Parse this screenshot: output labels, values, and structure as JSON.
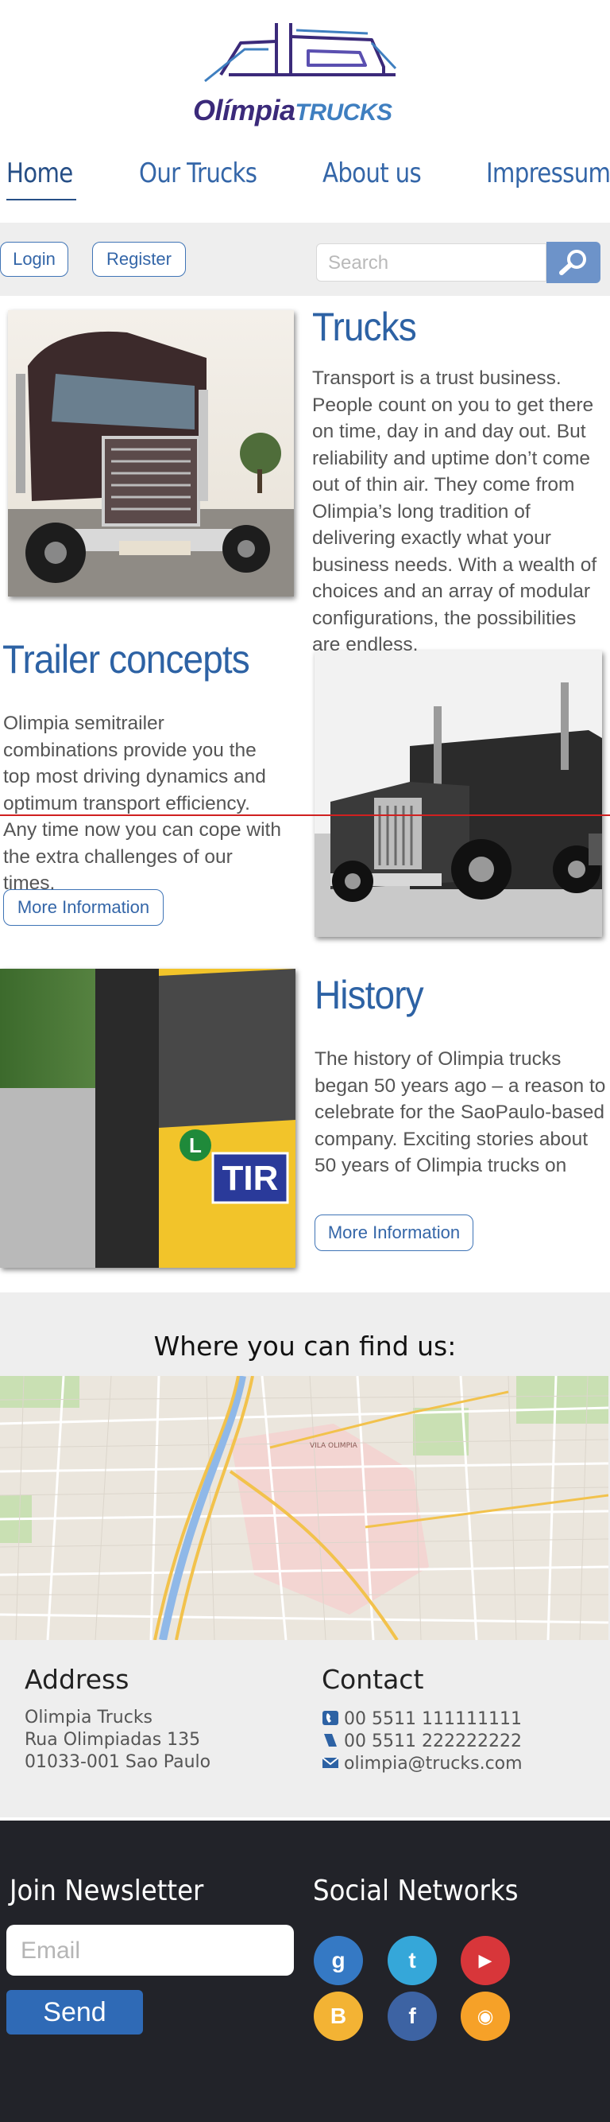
{
  "brand": {
    "name_part1": "Olímpia",
    "name_part2": "TRUCKS"
  },
  "nav": {
    "items": [
      {
        "label": "Home"
      },
      {
        "label": "Our Trucks"
      },
      {
        "label": "About us"
      },
      {
        "label": "Impressum"
      }
    ],
    "active": "Home"
  },
  "auth": {
    "login_label": "Login",
    "register_label": "Register"
  },
  "search": {
    "placeholder": "Search"
  },
  "sections": {
    "trucks": {
      "title": "Trucks",
      "text": "Transport is a trust business. People count on you to get there on time, day in and day out. But reliability and uptime don’t come out of thin air. They come from Olimpia’s long tradition of delivering exactly what your business needs. With a wealth of choices and an array of modular configurations, the possibilities are endless."
    },
    "trailer": {
      "title": "Trailer concepts",
      "text": "Olimpia semitrailer combinations provide you the top most driving dynamics and optimum transport efficiency. Any time now you can cope with the extra challenges of our times.",
      "button": "More Information"
    },
    "history": {
      "title": "History",
      "text": "The history of Olimpia trucks began 50 years ago – a reason to celebrate for the SaoPaulo-based company. Exciting stories about 50 years of Olimpia trucks on",
      "button": "More Information",
      "photo_badge": "TIR",
      "photo_letter": "L"
    }
  },
  "location": {
    "title": "Where you can find us:",
    "address": {
      "heading": "Address",
      "lines": [
        "Olimpia Trucks",
        "Rua Olimpiadas 135",
        "01033-001 Sao Paulo"
      ]
    },
    "contact": {
      "heading": "Contact",
      "phone1": "00 5511 111111111",
      "phone2": "00 5511 222222222",
      "email": "olimpia@trucks.com"
    },
    "map_label": "VILA OLIMPIA"
  },
  "footer": {
    "newsletter": {
      "heading": "Join Newsletter",
      "placeholder": "Email",
      "send_label": "Send"
    },
    "social": {
      "heading": "Social Networks",
      "icons": [
        {
          "name": "google-plus-icon",
          "glyph": "g",
          "color": "#3579c4"
        },
        {
          "name": "twitter-icon",
          "glyph": "t",
          "color": "#35a7d9"
        },
        {
          "name": "youtube-icon",
          "glyph": "▶",
          "color": "#d8363a"
        },
        {
          "name": "blogger-icon",
          "glyph": "B",
          "color": "#f3b334"
        },
        {
          "name": "facebook-icon",
          "glyph": "f",
          "color": "#3d63a3"
        },
        {
          "name": "rss-icon",
          "glyph": "◉",
          "color": "#f6a128"
        }
      ]
    }
  },
  "colors": {
    "accent": "#2d62a4",
    "footer_bg": "#222329",
    "band_bg": "#eeeeee"
  }
}
